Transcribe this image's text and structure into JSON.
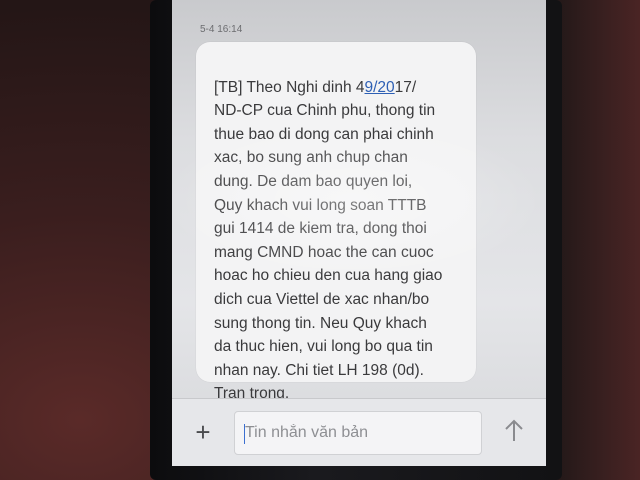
{
  "message": {
    "timestamp": "5-4 16:14",
    "lines": [
      [
        "[TB] Theo Nghi dinh 4",
        "9/20",
        "17/"
      ],
      [
        "ND-CP cua Chinh phu, thong tin"
      ],
      [
        "thue bao di dong can phai chinh"
      ],
      [
        "xac, bo sung anh chup chan"
      ],
      [
        "dung. De dam bao quyen loi,"
      ],
      [
        "Quy khach vui long soan TTTB"
      ],
      [
        "gui 1414 de kiem tra, dong thoi"
      ],
      [
        "mang CMND hoac the can cuoc"
      ],
      [
        "hoac ho chieu den cua hang giao"
      ],
      [
        "dich cua Viettel de xac nhan/bo"
      ],
      [
        "sung thong tin. Neu Quy khach"
      ],
      [
        "da thuc hien, vui long bo qua tin"
      ],
      [
        "nhan nay. Chi tiet LH 198 (0d)."
      ],
      [
        "Tran trong."
      ]
    ]
  },
  "composer": {
    "add_icon": "plus-icon",
    "add_symbol": "+",
    "placeholder": "Tin nhắn văn bản",
    "value": "",
    "send_icon": "send-arrow-up-icon"
  },
  "colors": {
    "bubble": "#f3f3f4",
    "text": "#3a3a3c",
    "link": "#2d5fb4",
    "caret": "#3b6fd0"
  }
}
